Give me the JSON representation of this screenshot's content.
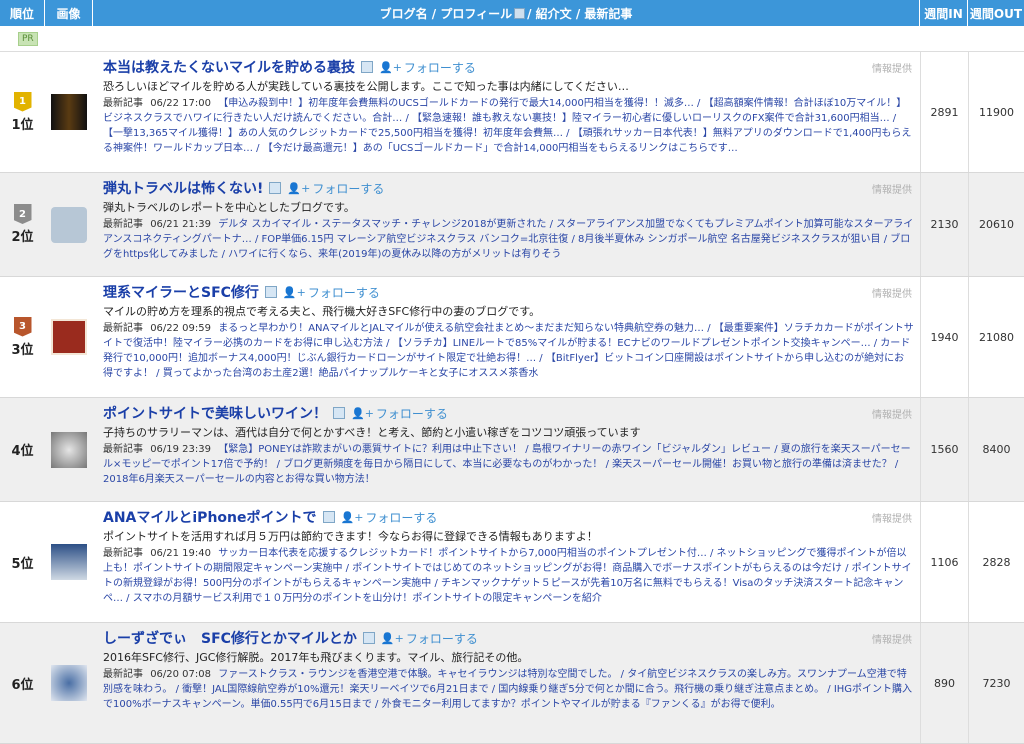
{
  "header": {
    "rank": "順位",
    "image": "画像",
    "main_pre": "ブログ名 / プロフィール",
    "main_post": "/ 紹介文 / 最新記事",
    "in": "週間IN",
    "out": "週間OUT"
  },
  "pr": "PR",
  "labels": {
    "follow": "フォローする",
    "info": "情報提供",
    "recent": "最新記事"
  },
  "rows": [
    {
      "rank": "1位",
      "medal": "1",
      "title": "本当は教えたくないマイルを貯める裏技",
      "desc": "恐ろしいほどマイルを貯める人が実践している裏技を公開します。ここで知った事は内緒にしてください…",
      "date": "06/22 17:00",
      "posts": "【申込み殺到中！】初年度年会費無料のUCSゴールドカードの発行で最大14,000円相当を獲得！！滅多… / 【超高額案件情報！合計ほぼ10万マイル！】ビジネスクラスでハワイに行きたい人だけ読んでください。合計… / 【緊急速報！誰も教えない裏技！】陸マイラー初心者に優しいローリスクのFX案件で合計31,600円相当… / 【一撃13,365マイル獲得！】あの人気のクレジットカードで25,500円相当を獲得！初年度年会費無… / 【頑張れサッカー日本代表！】無料アプリのダウンロードで1,400円もらえる神案件！ワールドカップ日本… / 【今だけ最高還元！】あの「UCSゴールドカード」で合計14,000円相当をもらえるリンクはこちらです…",
      "in": "2891",
      "out": "11900"
    },
    {
      "rank": "2位",
      "medal": "2",
      "title": "弾丸トラベルは怖くない!",
      "desc": "弾丸トラベルのレポートを中心としたブログです。",
      "date": "06/21 21:39",
      "posts": "デルタ スカイマイル・ステータスマッチ・チャレンジ2018が更新された / スターアライアンス加盟でなくてもプレミアムポイント加算可能なスターアライアンスコネクティングパートナ… / FOP単価6.15円 マレーシア航空ビジネスクラス バンコク=北京往復 / 8月後半夏休み シンガポール航空 名古屋発ビジネスクラスが狙い目 / ブログをhttps化してみました / ハワイに行くなら、来年(2019年)の夏休み以降の方がメリットは有りそう",
      "in": "2130",
      "out": "20610"
    },
    {
      "rank": "3位",
      "medal": "3",
      "title": "理系マイラーとSFC修行",
      "desc": "マイルの貯め方を理系的視点で考える夫と、飛行機大好きSFC修行中の妻のブログです。",
      "date": "06/22 09:59",
      "posts": "まるっと早わかり！ANAマイルとJALマイルが使える航空会社まとめ〜まだまだ知らない特典航空券の魅力… / 【最重要案件】ソラチカカードがポイントサイトで復活中！陸マイラー必携のカードをお得に申し込む方法 / 【ソラチカ】LINEルートで85%マイルが貯まる！ECナビのワールドプレゼントポイント交換キャンペー… / カード発行で10,000円！追加ボーナス4,000円！じぶん銀行カードローンがサイト限定で壮絶お得！… / 【BitFlyer】ビットコイン口座開設はポイントサイトから申し込むのが絶対にお得ですよ！ / 買ってよかった台湾のお土産2選！絶品パイナップルケーキと女子にオススメ茶香水",
      "in": "1940",
      "out": "21080"
    },
    {
      "rank": "4位",
      "medal": "",
      "title": "ポイントサイトで美味しいワイン！",
      "desc": "子持ちのサラリーマンは、酒代は自分で何とかすべき！と考え、節約と小遣い稼ぎをコツコツ頑張っています",
      "date": "06/19 23:39",
      "posts": "【緊急】PONEYは詐欺まがいの悪質サイトに？利用は中止下さい！ / 島根ワイナリーの赤ワイン「ビジャルダン」レビュー / 夏の旅行を楽天スーパーセール×モッピーでポイント17倍で予約！ / ブログ更新頻度を毎日から隔日にして、本当に必要なものがわかった！ / 楽天スーパーセール開催！お買い物と旅行の準備は済ませた？ / 2018年6月楽天スーパーセールの内容とお得な買い物方法！",
      "in": "1560",
      "out": "8400"
    },
    {
      "rank": "5位",
      "medal": "",
      "title": "ANAマイルとiPhoneポイントで",
      "desc": "ポイントサイトを活用すれば月５万円は節約できます！今ならお得に登録できる情報もありますよ！",
      "date": "06/21 19:40",
      "posts": "サッカー日本代表を応援するクレジットカード！ポイントサイトから7,000円相当のポイントプレゼント付… / ネットショッピングで獲得ポイントが倍以上も！ポイントサイトの期間限定キャンペーン実施中 / ポイントサイトではじめてのネットショッピングがお得！商品購入でボーナスポイントがもらえるのは今だけ / ポイントサイトの新規登録がお得！500円分のポイントがもらえるキャンペーン実施中 / チキンマックナゲット５ピースが先着10万名に無料でもらえる！Visaのタッチ決済スタート記念キャンペ… / スマホの月額サービス利用で１０万円分のポイントを山分け！ポイントサイトの限定キャンペーンを紹介",
      "in": "1106",
      "out": "2828"
    },
    {
      "rank": "6位",
      "medal": "",
      "title": "しーずざでぃ　SFC修行とかマイルとか",
      "desc": "2016年SFC修行、JGC修行解脱。2017年も飛びまくります。マイル、旅行記その他。",
      "date": "06/20 07:08",
      "posts": "ファーストクラス・ラウンジを香港空港で体験。キャセイラウンジは特別な空間でした。 / タイ航空ビジネスクラスの楽しみ方。スワンナプーム空港で特別感を味わう。 / 衝撃！JAL国際線航空券が10%還元！楽天リーベイツで6月21日まで / 国内線乗り継ぎ5分で何とか間に合う。飛行機の乗り継ぎ注意点まとめ。 / IHGポイント購入で100%ボーナスキャンペーン。単価0.55円で6月15日まで / 外食モニター利用してますか？ポイントやマイルが貯まる『ファンくる』がお得で便利。",
      "in": "890",
      "out": "7230"
    }
  ]
}
